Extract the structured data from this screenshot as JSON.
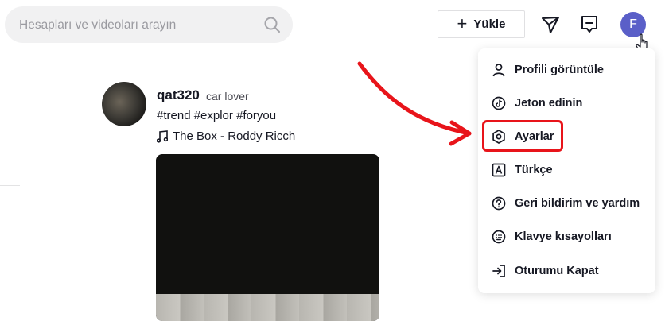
{
  "search": {
    "placeholder": "Hesapları ve videoları arayın"
  },
  "header": {
    "upload_label": "Yükle",
    "avatar_letter": "F"
  },
  "post": {
    "username": "qat320",
    "nickname": "car lover",
    "hashtags": "#trend #explor #foryou",
    "music": "The Box - Roddy Ricch"
  },
  "menu": {
    "items": [
      {
        "label": "Profili görüntüle",
        "icon": "person-icon"
      },
      {
        "label": "Jeton edinin",
        "icon": "coin-icon"
      },
      {
        "label": "Ayarlar",
        "icon": "settings-icon"
      },
      {
        "label": "Türkçe",
        "icon": "language-icon"
      },
      {
        "label": "Geri bildirim ve yardım",
        "icon": "help-icon"
      },
      {
        "label": "Klavye kısayolları",
        "icon": "keyboard-icon"
      }
    ],
    "logout": {
      "label": "Oturumu Kapat",
      "icon": "logout-icon"
    }
  },
  "colors": {
    "annotation": "#e8141a",
    "avatar_bg": "#5a5fc8"
  }
}
